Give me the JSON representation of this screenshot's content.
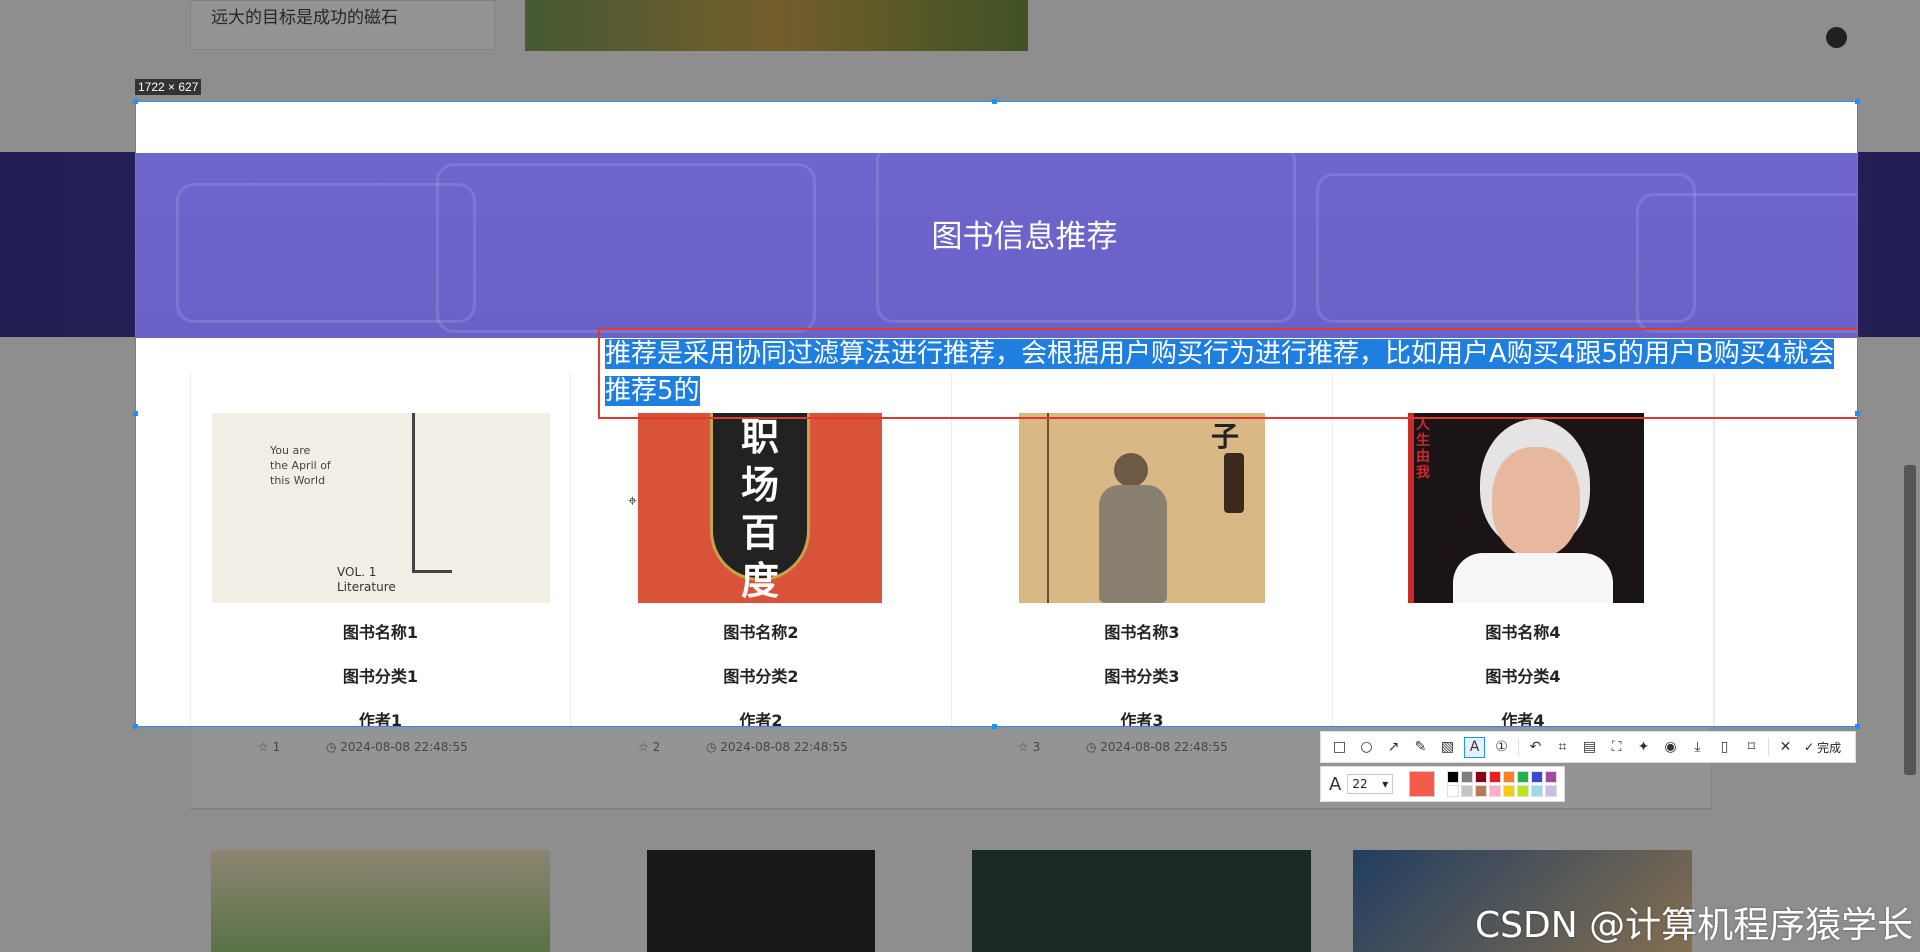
{
  "background": {
    "motto": "远大的目标是成功的磁石",
    "stats": [
      {
        "count": "1",
        "time": "2024-08-08 22:48:55"
      },
      {
        "count": "2",
        "time": "2024-08-08 22:48:55"
      },
      {
        "count": "3",
        "time": "2024-08-08 22:48:55"
      }
    ]
  },
  "capture": {
    "size_label": "1722 × 627",
    "banner_title": "图书信息推荐",
    "annotation": "推荐是采用协同过滤算法进行推荐，会根据用户购买行为进行推荐，比如用户A购买4跟5的用户B购买4就会推荐5的",
    "books": [
      {
        "name": "图书名称1",
        "category": "图书分类1",
        "author": "作者1"
      },
      {
        "name": "图书名称2",
        "category": "图书分类2",
        "author": "作者2"
      },
      {
        "name": "图书名称3",
        "category": "图书分类3",
        "author": "作者3"
      },
      {
        "name": "图书名称4",
        "category": "图书分类4",
        "author": "作者4"
      }
    ],
    "cover_texts": {
      "book1_line1": "You are",
      "book1_line2": "the April of",
      "book1_line3": "this World",
      "book1_vol": "VOL. 1",
      "book1_lit": "Literature",
      "book2": "职场百度",
      "book3": "子",
      "book4": "人生由我"
    }
  },
  "toolbar": {
    "done_label": "完成",
    "font_size": "22",
    "current_color": "#f55a4a",
    "palette": [
      "#000000",
      "#7f7f7f",
      "#880015",
      "#ed1c24",
      "#ff7f27",
      "#22b14c",
      "#3f48cc",
      "#a349a4",
      "#ffffff",
      "#c3c3c3",
      "#b97a57",
      "#ffaec9",
      "#ffc90e",
      "#b5e61d",
      "#99d9ea",
      "#c8bfe7"
    ]
  },
  "watermark": "CSDN @计算机程序猿学长"
}
